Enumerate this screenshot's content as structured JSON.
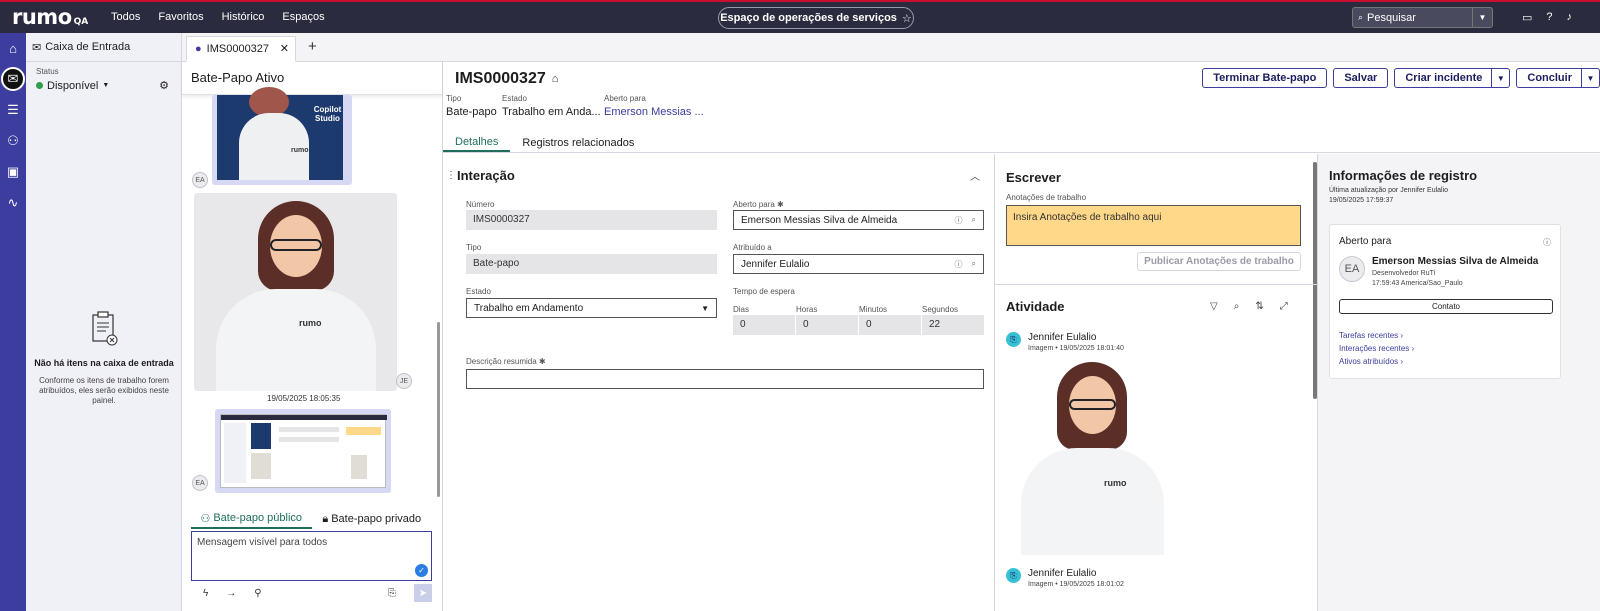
{
  "topbar": {
    "logo": "rumo",
    "logo_suffix": "QA",
    "nav": [
      "Todos",
      "Favoritos",
      "Histórico",
      "Espaços"
    ],
    "workspace": "Espaço de operações de serviços",
    "search_placeholder": "Pesquisar"
  },
  "inbox": {
    "title": "Caixa de Entrada",
    "status_label": "Status",
    "status_value": "Disponível",
    "empty_title": "Não há itens na caixa de entrada",
    "empty_desc": "Conforme os itens de trabalho forem atribuídos, eles serão exibidos neste painel."
  },
  "tabs": {
    "active_tab": "IMS0000327"
  },
  "chat": {
    "header": "Bate-Papo Ativo",
    "avatars": [
      "EA",
      "JE",
      "EA"
    ],
    "image_brand": "rumo",
    "copilot_label": "Copilot Studio",
    "timestamp": "19/05/2025 18:05:35",
    "tab_public": "Bate-papo público",
    "tab_private": "Bate-papo privado",
    "message_placeholder": "Mensagem visível para todos"
  },
  "record": {
    "id": "IMS0000327",
    "meta": [
      {
        "label": "Tipo",
        "value": "Bate-papo"
      },
      {
        "label": "Estado",
        "value": "Trabalho em Anda..."
      },
      {
        "label": "Aberto para",
        "value": "Emerson Messias ..."
      }
    ],
    "buttons": {
      "end_chat": "Terminar Bate-papo",
      "save": "Salvar",
      "create_incident": "Criar incidente",
      "conclude": "Concluir"
    },
    "detail_tabs": [
      "Detalhes",
      "Registros relacionados"
    ]
  },
  "form": {
    "section": "Interação",
    "numero_label": "Número",
    "numero_value": "IMS0000327",
    "aberto_label": "Aberto para",
    "aberto_value": "Emerson Messias Silva de Almeida",
    "tipo_label": "Tipo",
    "tipo_value": "Bate-papo",
    "atribuido_label": "Atribuído a",
    "atribuido_value": "Jennifer Eulalio",
    "estado_label": "Estado",
    "estado_value": "Trabalho em Andamento",
    "espera_label": "Tempo de espera",
    "espera_cols": [
      "Dias",
      "Horas",
      "Minutos",
      "Segundos"
    ],
    "espera_vals": [
      "0",
      "0",
      "0",
      "22"
    ],
    "desc_label": "Descrição resumida"
  },
  "compose": {
    "title": "Escrever",
    "notes_label": "Anotações de trabalho",
    "notes_placeholder": "Insira Anotações de trabalho aqui",
    "publish": "Publicar Anotações de trabalho",
    "activity_title": "Atividade",
    "entries": [
      {
        "name": "Jennifer Eulalio",
        "detail": "Imagem • 19/05/2025 18:01:40"
      },
      {
        "name": "Jennifer Eulalio",
        "detail": "Imagem • 19/05/2025 18:01:02"
      }
    ]
  },
  "info": {
    "title": "Informações de registro",
    "updated": "Última atualização por Jennifer Eulalio",
    "updated_at": "19/05/2025 17:59:37",
    "card_title": "Aberto para",
    "initials": "EA",
    "person": "Emerson Messias Silva de Almeida",
    "role": "Desenvolvedor RuTi",
    "time": "17:59:43 America/Sao_Paulo",
    "contact": "Contato",
    "links": [
      "Tarefas recentes",
      "Interações recentes",
      "Ativos atribuídos"
    ]
  }
}
